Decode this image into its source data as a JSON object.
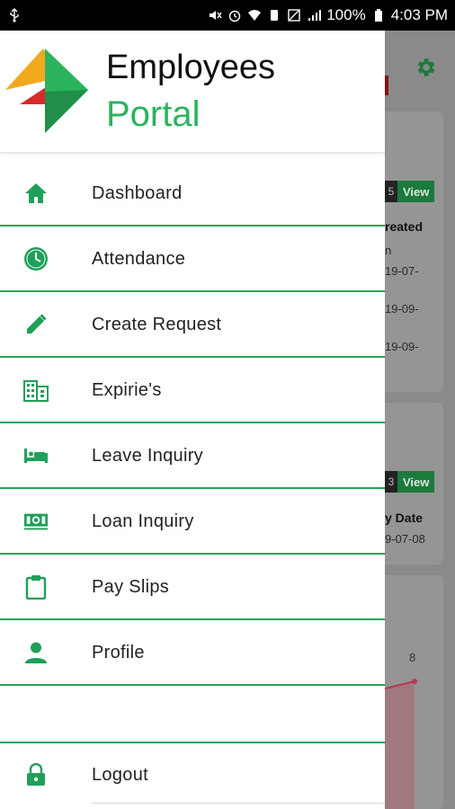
{
  "status_bar": {
    "battery": "100%",
    "time": "4:03 PM"
  },
  "app": {
    "title_line1": "Employees",
    "title_line2": "Portal"
  },
  "menu": [
    {
      "label": "Dashboard",
      "icon": "home-icon"
    },
    {
      "label": "Attendance",
      "icon": "clock-icon"
    },
    {
      "label": "Create Request",
      "icon": "pencil-icon"
    },
    {
      "label": "Expirie's",
      "icon": "building-icon"
    },
    {
      "label": "Leave Inquiry",
      "icon": "bed-icon"
    },
    {
      "label": "Loan Inquiry",
      "icon": "money-icon"
    },
    {
      "label": "Pay Slips",
      "icon": "clipboard-icon"
    },
    {
      "label": "Profile",
      "icon": "person-icon"
    }
  ],
  "logout": {
    "label": "Logout",
    "icon": "lock-icon"
  },
  "background": {
    "card1": {
      "count": "5",
      "view": "View",
      "heading": "reated",
      "sub": "n",
      "dates": [
        "19-07-",
        "19-09-",
        "19-09-"
      ]
    },
    "card2": {
      "count": "3",
      "view": "View",
      "heading": "y Date",
      "date": "9-07-08"
    },
    "chart_value": "8"
  },
  "colors": {
    "accent": "#2bb35e",
    "divider": "#27a457",
    "icon": "#1fa058"
  }
}
